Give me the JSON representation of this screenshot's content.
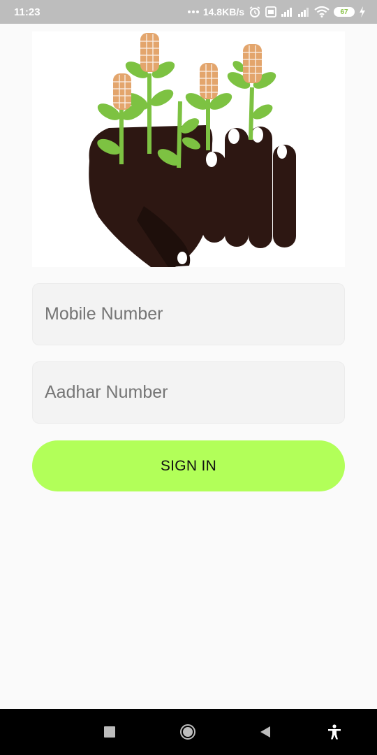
{
  "status_bar": {
    "time": "11:23",
    "network_speed": "14.8KB/s",
    "battery_level": "67",
    "icons": [
      "ellipsis-icon",
      "alarm-icon",
      "volte-icon",
      "signal-icon",
      "signal-icon",
      "wifi-icon",
      "battery-icon",
      "charging-icon"
    ]
  },
  "hero": {
    "image": "farmer-hand-with-corn-illustration",
    "colors": {
      "soil": "#2d1712",
      "leaf": "#7dc242",
      "corn": "#e3a56c"
    }
  },
  "form": {
    "mobile_placeholder": "Mobile Number",
    "aadhar_placeholder": "Aadhar Number",
    "signin_label": "SIGN IN",
    "accent": "#b2ff59"
  },
  "nav_bar": {
    "icons": [
      "recent-apps-icon",
      "home-icon",
      "back-icon",
      "accessibility-icon"
    ]
  }
}
